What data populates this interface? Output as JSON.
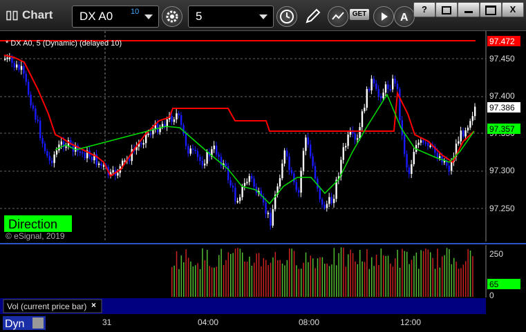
{
  "window": {
    "title": "Chart",
    "help_label": "?",
    "restore_label": "",
    "minimize_label": "",
    "maximize_label": "",
    "close_label": "X"
  },
  "toolbar": {
    "symbol": "DX A0",
    "symbol_badge": "10",
    "interval": "5",
    "get_label": "GET"
  },
  "chart": {
    "caption": "* DX A0, 5 (Dynamic) (delayed 10)",
    "direction_label": "Direction",
    "copyright": "© eSignal, 2019",
    "price_ticks": [
      "97.450",
      "97.400",
      "97.350",
      "97.300",
      "97.250"
    ],
    "tag_red": "97.472",
    "tag_last": "97.386",
    "tag_green": "97.357",
    "vol_label": "Vol (current price bar)",
    "vol_ticks": [
      "250",
      "0"
    ],
    "vol_tag": "65",
    "x_ticks": [
      "31",
      "04:00",
      "08:00",
      "12:00"
    ],
    "footer_label": "Dyn",
    "colors": {
      "up": "#ffffff",
      "down": "#1a1aff",
      "red_line": "#ff0000",
      "green_line": "#00e000",
      "direction_bg": "#00ff00"
    }
  }
}
